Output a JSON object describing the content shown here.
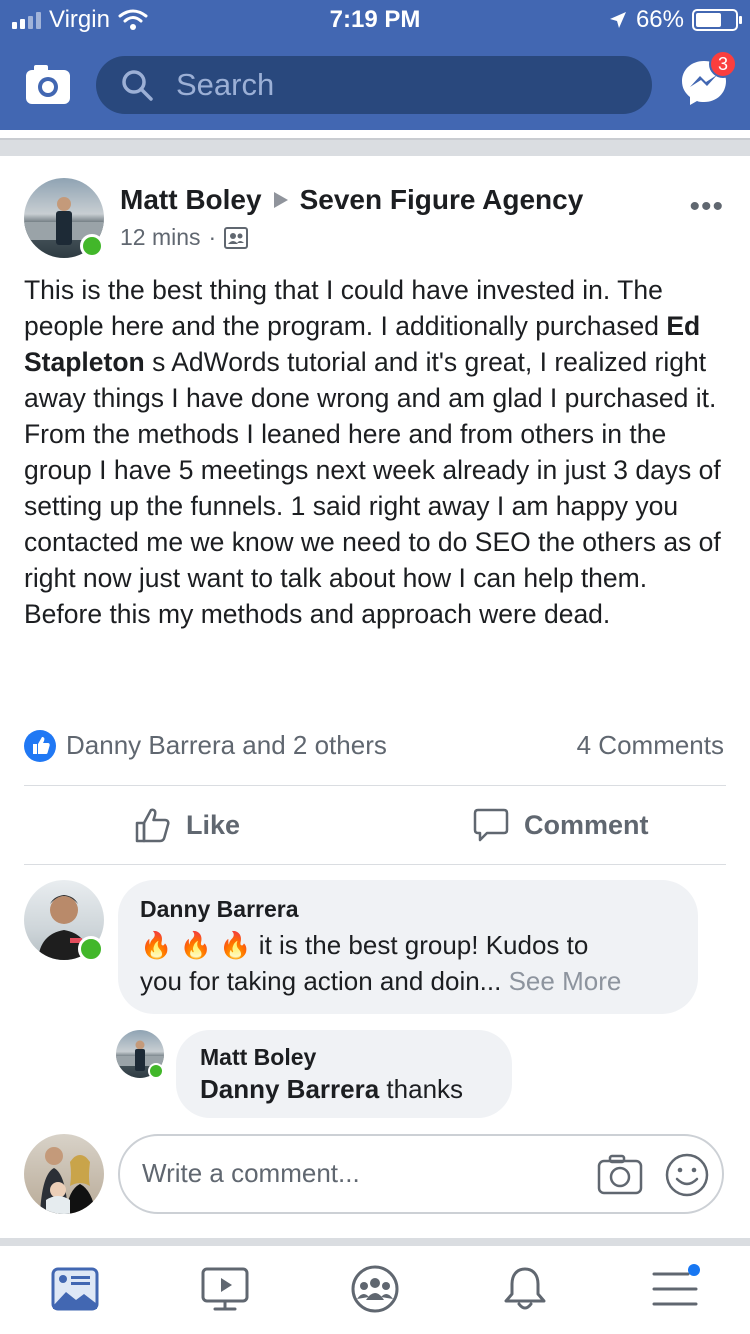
{
  "status_bar": {
    "carrier": "Virgin",
    "time": "7:19 PM",
    "battery_text": "66%",
    "battery_level": 0.66
  },
  "header": {
    "search_placeholder": "Search",
    "messenger_badge": "3",
    "accent_color": "#4267b2",
    "icons": [
      "camera-icon",
      "search-icon",
      "messenger-icon"
    ]
  },
  "post": {
    "author": "Matt Boley",
    "group": "Seven Figure Agency",
    "time": "12 mins",
    "text_parts": [
      "This is the best thing that I could have invested in. The people here and the program.  I additionally purchased ",
      "Ed Stapleton",
      " s AdWords tutorial and it's great, I realized right away things I have done wrong and am glad I purchased it.  From the methods I leaned here and from others in the group I have 5 meetings next week already in just 3 days of setting up the funnels.  1 said right away I am happy you contacted me we know we need to do SEO the others as of right now just want to talk about how I can help them.  Before this my methods and approach were dead."
    ],
    "reactions_text": "Danny Barrera and 2 others",
    "comments_count": "4 Comments",
    "actions": {
      "like": "Like",
      "comment": "Comment"
    }
  },
  "comments": [
    {
      "author": "Danny Barrera",
      "emoji": "🔥 🔥 🔥",
      "text_line1": " it is the best group! Kudos to",
      "text_line2": "you for taking action and doin...",
      "see_more": "See More"
    },
    {
      "author": "Matt Boley",
      "mention": "Danny Barrera",
      "text": " thanks"
    }
  ],
  "composer": {
    "placeholder": "Write a comment..."
  },
  "tabbar": {
    "items": [
      "news-feed-icon",
      "watch-icon",
      "groups-icon",
      "notifications-icon",
      "menu-icon"
    ],
    "active": "news-feed-icon"
  }
}
